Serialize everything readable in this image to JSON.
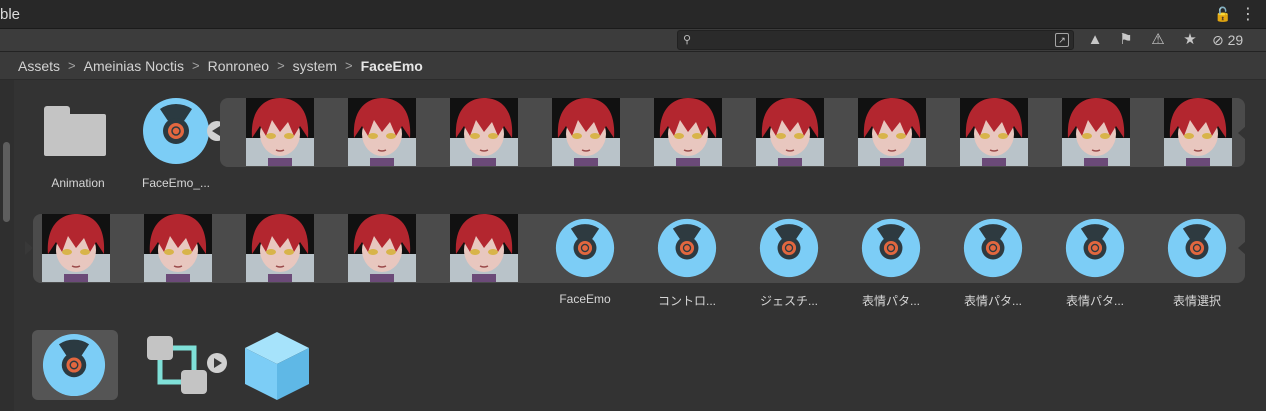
{
  "window": {
    "title_fragment": "ble",
    "lock_icon": "lock-icon",
    "menu_icon": "kebab-menu-icon"
  },
  "toolbar": {
    "search_value": "",
    "search_icon": "search-icon",
    "search_advanced_icon": "advanced-search-icon",
    "buttons": [
      "filter-by-type-icon",
      "filter-by-label-icon",
      "log-icon",
      "favorite-icon"
    ],
    "hidden_count": "29"
  },
  "breadcrumb": [
    "Assets",
    "Ameinias Noctis",
    "Ronroneo",
    "system",
    "FaceEmo"
  ],
  "row1": {
    "folder_label": "Animation",
    "asset_label": "FaceEmo_...",
    "face_count": 10
  },
  "row2": {
    "face_count": 5,
    "assets": [
      "FaceEmo",
      "コントロ...",
      "ジェスチ...",
      "表情パタ...",
      "表情パタ...",
      "表情パタ...",
      "表情選択"
    ]
  },
  "colors": {
    "accent_blue": "#7ccdf6",
    "faceemo_ring": "#2e3a40",
    "faceemo_core": "#e2673f",
    "hair": "#b3262f",
    "skin": "#e8c7bf"
  }
}
